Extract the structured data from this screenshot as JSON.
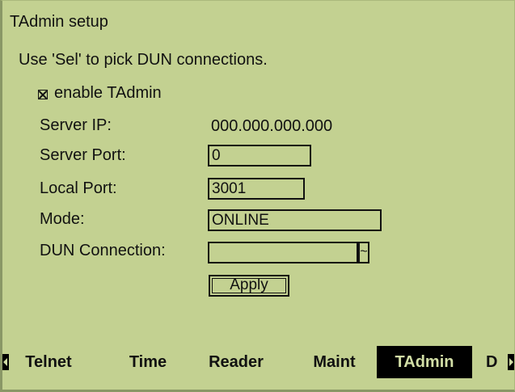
{
  "screen": {
    "title": "TAdmin setup",
    "hint": "Use 'Sel' to pick DUN connections."
  },
  "form": {
    "enable_label": "enable TAdmin",
    "enable_checked": true,
    "server_ip": {
      "label": "Server IP:",
      "value": "000.000.000.000"
    },
    "server_port": {
      "label": "Server Port:",
      "value": "0"
    },
    "local_port": {
      "label": "Local Port:",
      "value": "3001"
    },
    "mode": {
      "label": "Mode:",
      "value": "ONLINE"
    },
    "dun_connection": {
      "label": "DUN Connection:",
      "value": "",
      "arrow_glyph": "~"
    },
    "apply_label": "Apply"
  },
  "tabs": {
    "items": [
      {
        "label": "Telnet"
      },
      {
        "label": "Time"
      },
      {
        "label": "Reader"
      },
      {
        "label": "Maint"
      },
      {
        "label": "TAdmin",
        "active": true
      },
      {
        "label": "D"
      }
    ]
  }
}
